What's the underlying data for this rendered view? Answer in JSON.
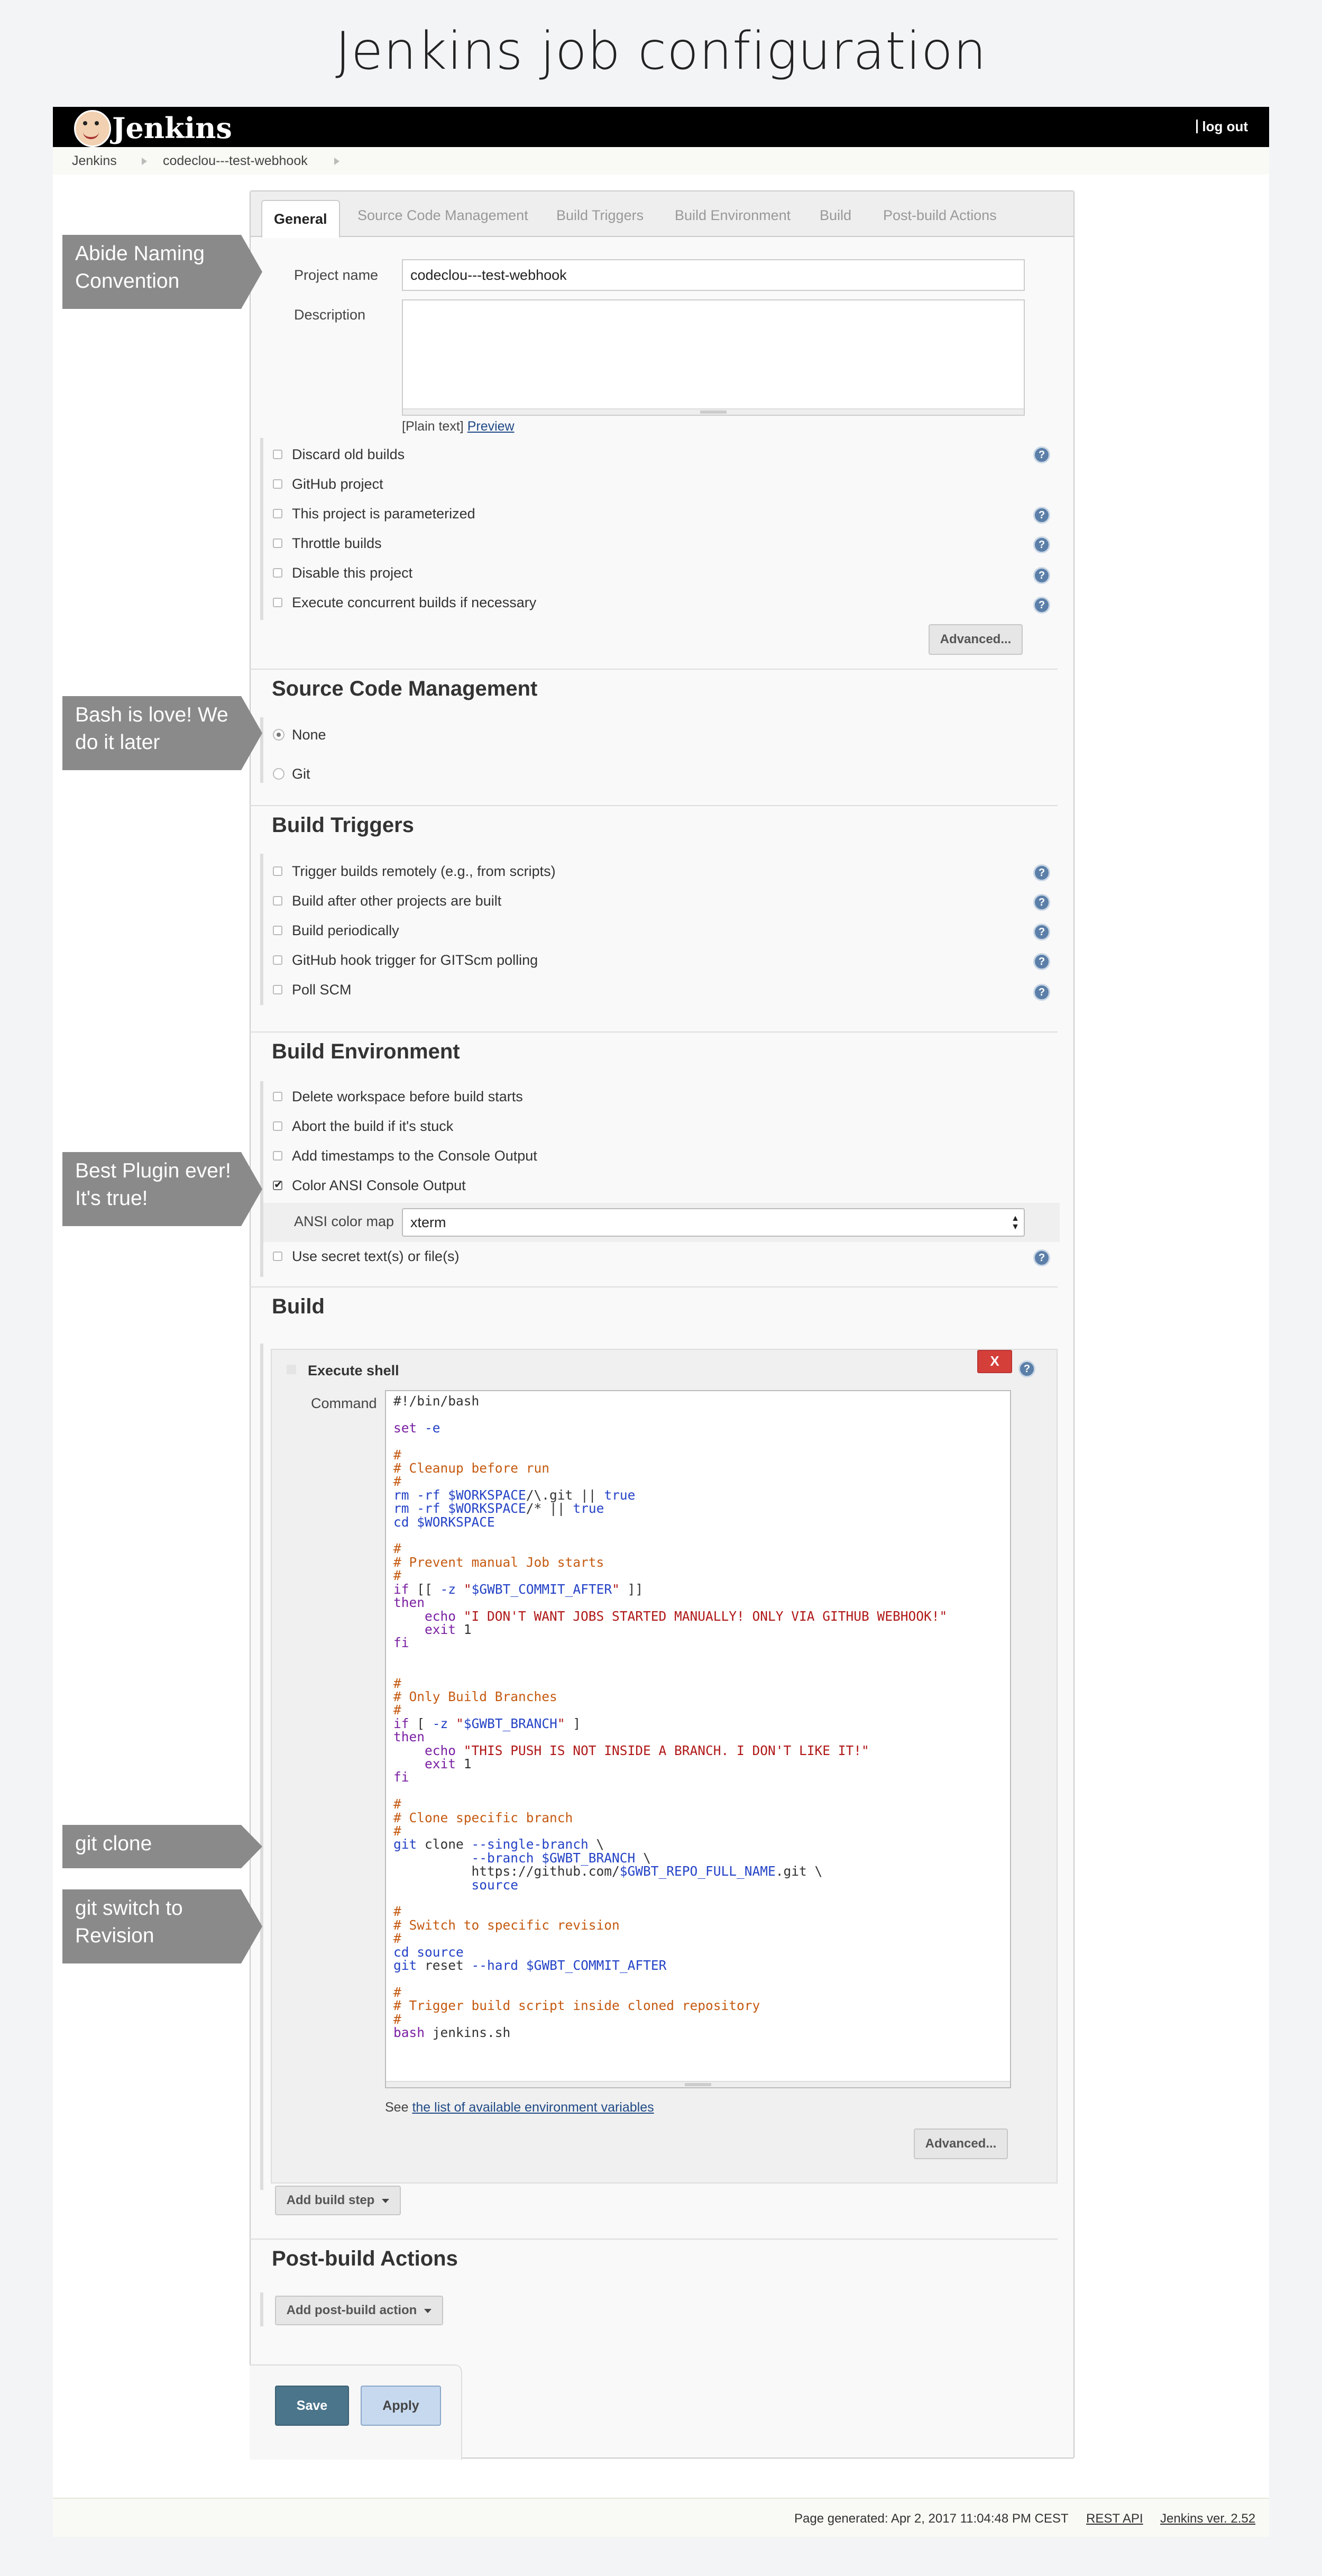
{
  "page_title": "Jenkins job configuration",
  "header": {
    "logo_text": "Jenkins",
    "logout": "log out"
  },
  "breadcrumbs": [
    "Jenkins",
    "codeclou---test-webhook"
  ],
  "tabs": [
    "General",
    "Source Code Management",
    "Build Triggers",
    "Build Environment",
    "Build",
    "Post-build Actions"
  ],
  "general": {
    "project_name_label": "Project name",
    "project_name_value": "codeclou---test-webhook",
    "description_label": "Description",
    "plain_text": "[Plain text]",
    "preview": "Preview",
    "options": [
      "Discard old builds",
      "GitHub project",
      "This project is parameterized",
      "Throttle builds",
      "Disable this project",
      "Execute concurrent builds if necessary"
    ],
    "advanced": "Advanced..."
  },
  "scm": {
    "title": "Source Code Management",
    "options": [
      "None",
      "Git"
    ],
    "selected": "None"
  },
  "triggers": {
    "title": "Build Triggers",
    "options": [
      "Trigger builds remotely (e.g., from scripts)",
      "Build after other projects are built",
      "Build periodically",
      "GitHub hook trigger for GITScm polling",
      "Poll SCM"
    ]
  },
  "environment": {
    "title": "Build Environment",
    "options": [
      "Delete workspace before build starts",
      "Abort the build if it's stuck",
      "Add timestamps to the Console Output",
      "Color ANSI Console Output"
    ],
    "checked": "Color ANSI Console Output",
    "ansi_label": "ANSI color map",
    "ansi_value": "xterm",
    "secret": "Use secret text(s) or file(s)"
  },
  "build": {
    "title": "Build",
    "step_title": "Execute shell",
    "delete": "X",
    "command_label": "Command",
    "see_text": "See",
    "env_link": "the list of available environment variables",
    "advanced": "Advanced...",
    "add_step": "Add build step"
  },
  "post_build": {
    "title": "Post-build Actions",
    "add_action": "Add post-build action"
  },
  "buttons": {
    "save": "Save",
    "apply": "Apply"
  },
  "footer": {
    "generated": "Page generated: Apr 2, 2017 11:04:48 PM CEST",
    "rest_api": "REST API",
    "version": "Jenkins ver. 2.52"
  },
  "callouts": [
    "Abide Naming Convention",
    "Bash is love! We do it later",
    "Best Plugin ever! It's true!",
    "git clone",
    "git switch to Revision"
  ],
  "help_icon": "question-mark",
  "colors": {
    "topbar": "#000000",
    "callout": "#8a8a8a",
    "save_button": "#4b758b",
    "delete_button": "#d43f3a"
  }
}
